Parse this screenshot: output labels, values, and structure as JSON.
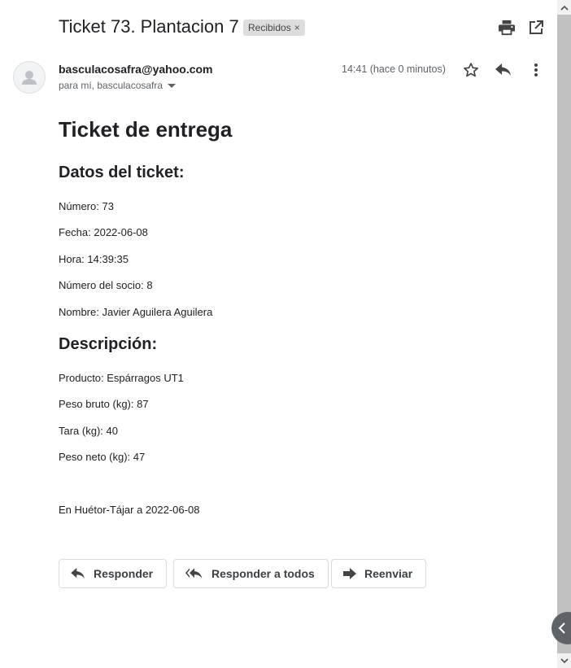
{
  "email": {
    "subject": "Ticket 73. Plantacion 7",
    "label": "Recibidos",
    "label_remove": "×",
    "sender": "basculacosafra@yahoo.com",
    "recipients": "para mí, basculacosafra",
    "time": "14:41 (hace 0 minutos)"
  },
  "body": {
    "title": "Ticket de entrega",
    "section1_title": "Datos del ticket:",
    "numero": "Número: 73",
    "fecha": "Fecha: 2022-06-08",
    "hora": "Hora: 14:39:35",
    "numero_socio": "Número del socio: 8",
    "nombre": "Nombre: Javier Aguilera Aguilera",
    "section2_title": "Descripción:",
    "producto": "Producto: Espárragos UT1",
    "peso_bruto": "Peso bruto (kg): 87",
    "tara": "Tara (kg): 40",
    "peso_neto": "Peso neto (kg): 47",
    "lugar_fecha": "En Huétor-Tájar a 2022-06-08"
  },
  "actions": {
    "reply": "Responder",
    "reply_all": "Responder a todos",
    "forward": "Reenviar"
  },
  "icons": {
    "print": "print-icon",
    "open_new_window": "open-in-new-icon",
    "star": "star-icon",
    "reply": "reply-icon",
    "more": "more-vert-icon",
    "avatar": "person-icon",
    "dropdown": "caret-down-icon",
    "side_toggle": "chevron-left-icon"
  },
  "colors": {
    "text": "#202124",
    "secondary": "#5f6368",
    "label_bg": "#dddddd"
  }
}
